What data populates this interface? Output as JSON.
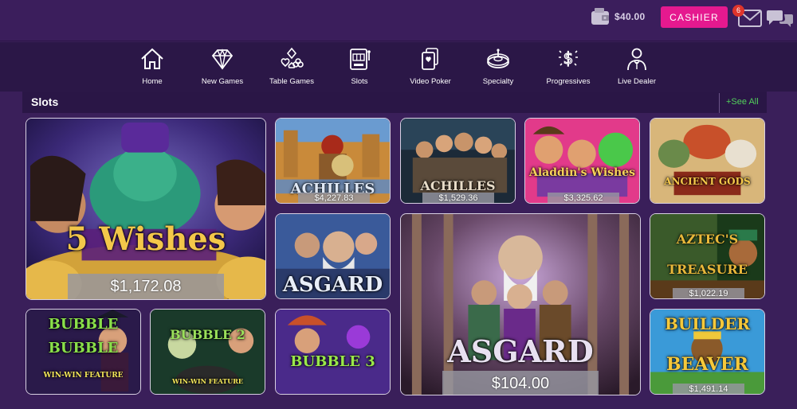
{
  "header": {
    "balance": "$40.00",
    "cashier_label": "CASHIER",
    "mail_count": "6"
  },
  "nav": {
    "items": [
      {
        "label": "Home",
        "icon": "home-icon"
      },
      {
        "label": "New Games",
        "icon": "diamond-icon"
      },
      {
        "label": "Table Games",
        "icon": "card-suits-icon"
      },
      {
        "label": "Slots",
        "icon": "slot-machine-icon"
      },
      {
        "label": "Video Poker",
        "icon": "playing-cards-icon"
      },
      {
        "label": "Specialty",
        "icon": "roulette-icon"
      },
      {
        "label": "Progressives",
        "icon": "money-bag-icon"
      },
      {
        "label": "Live Dealer",
        "icon": "dealer-icon"
      }
    ]
  },
  "section": {
    "title": "Slots",
    "see_all": "+See All"
  },
  "games": {
    "five_wishes": {
      "jackpot": "$1,172.08"
    },
    "achilles_1": {
      "jackpot": "$4,227.83"
    },
    "achilles_2": {
      "jackpot": "$1,529.36"
    },
    "aladdins_wishes": {
      "jackpot": "$3,325.62"
    },
    "ancient_gods": {},
    "asgard": {},
    "asgard_deluxe": {
      "jackpot": "$104.00"
    },
    "aztecs_treasure": {
      "jackpot": "$1,022.19"
    },
    "bubble_bubble": {},
    "bubble_bubble_2": {},
    "bubble_bubble_3": {},
    "builder_beaver": {
      "jackpot": "$1,491.14"
    }
  },
  "colors": {
    "page_bg": "#3a1f5a",
    "nav_bg": "#2b1747",
    "cashier_bg": "#e5198f",
    "see_all": "#52d05b",
    "badge": "#e0352b"
  }
}
